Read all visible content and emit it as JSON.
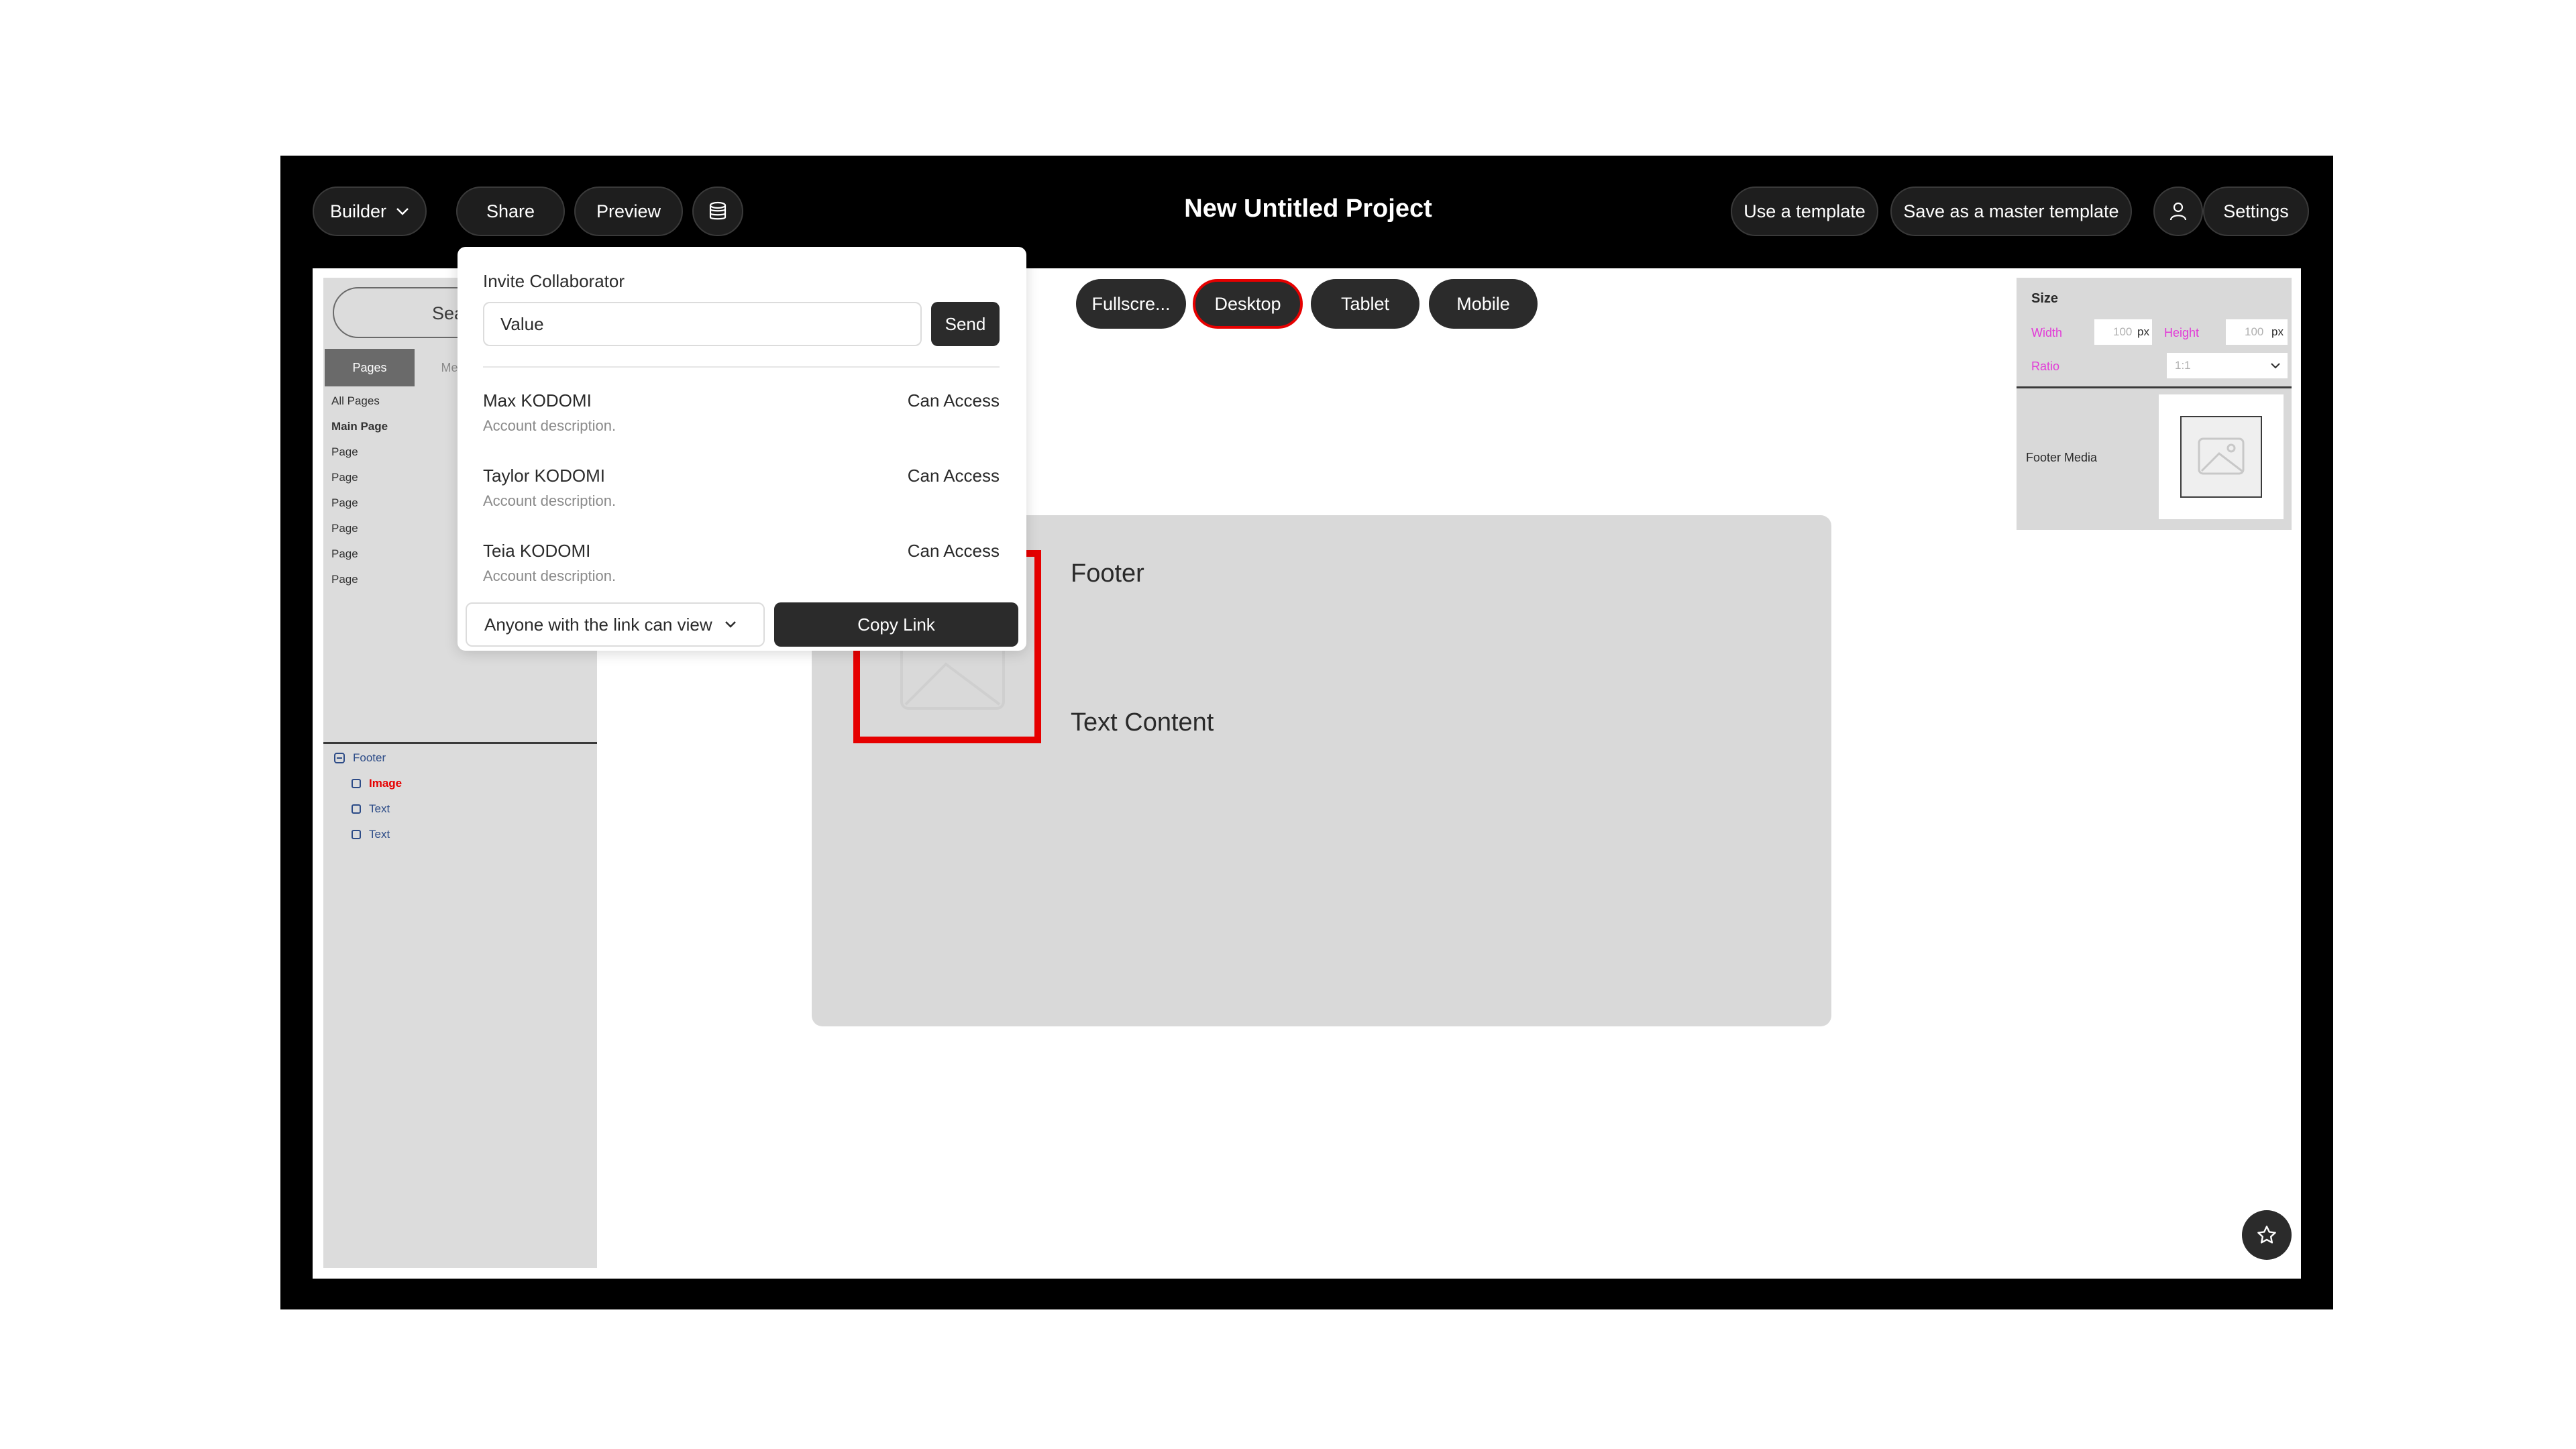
{
  "topbar": {
    "builder_label": "Builder",
    "share_label": "Share",
    "preview_label": "Preview",
    "project_title": "New Untitled Project",
    "use_template_label": "Use a template",
    "save_master_label": "Save as a master template",
    "settings_label": "Settings"
  },
  "device_toggle": {
    "fullscreen": "Fullscre...",
    "desktop": "Desktop",
    "tablet": "Tablet",
    "mobile": "Mobile",
    "selected": "Desktop"
  },
  "left_panel": {
    "search_placeholder": "Sea",
    "tabs": [
      "Pages",
      "Me"
    ],
    "pages": [
      "All Pages",
      "Main Page",
      "Page",
      "Page",
      "Page",
      "Page",
      "Page",
      "Page"
    ],
    "tree": {
      "root": "Footer",
      "children": [
        "Image",
        "Text",
        "Text"
      ]
    }
  },
  "share_popup": {
    "title": "Invite Collaborator",
    "input_value": "Value",
    "send_label": "Send",
    "collaborators": [
      {
        "name": "Max KODOMI",
        "description": "Account description.",
        "access": "Can Access"
      },
      {
        "name": "Taylor KODOMI",
        "description": "Account description.",
        "access": "Can Access"
      },
      {
        "name": "Teia KODOMI",
        "description": "Account description.",
        "access": "Can Access"
      }
    ],
    "link_permission": "Anyone with the link can view",
    "copy_link_label": "Copy Link"
  },
  "content": {
    "heading": "Footer",
    "text": "Text Content"
  },
  "right_panel": {
    "section_title": "Size",
    "width_label": "Width",
    "width_value": "100",
    "width_unit": "px",
    "height_label": "Height",
    "height_value": "100",
    "height_unit": "px",
    "ratio_label": "Ratio",
    "ratio_value": "1:1",
    "media_label": "Footer Media"
  },
  "colors": {
    "accent_red": "#e60000",
    "label_pink": "#e23ad7",
    "tree_blue": "#2c4b87"
  }
}
